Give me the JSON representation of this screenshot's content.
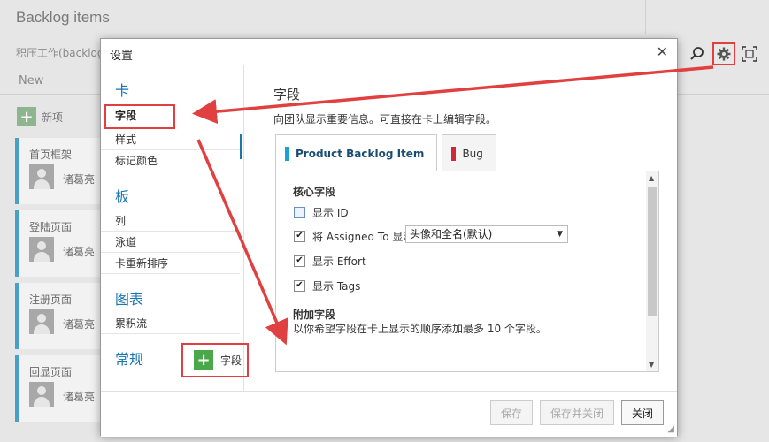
{
  "background": {
    "title": "Backlog items",
    "breadcrumb": "积压工作(backlog",
    "new_tab": "New",
    "new_button": "新项",
    "cards": [
      {
        "title": "首页框架",
        "owner": "诸葛亮"
      },
      {
        "title": "登陆页面",
        "owner": "诸葛亮"
      },
      {
        "title": "注册页面",
        "owner": "诸葛亮"
      },
      {
        "title": "回显页面",
        "owner": "诸葛亮"
      }
    ],
    "icons": {
      "search": "search-icon",
      "settings": "gear-icon",
      "fullscreen": "fullscreen-icon"
    }
  },
  "dialog": {
    "title": "设置",
    "close": "✕",
    "nav": {
      "sections": [
        {
          "label": "卡",
          "items": [
            "字段",
            "样式",
            "标记颜色"
          ]
        },
        {
          "label": "板",
          "items": [
            "列",
            "泳道",
            "卡重新排序"
          ]
        },
        {
          "label": "图表",
          "items": [
            "累积流"
          ]
        },
        {
          "label": "常规",
          "items": []
        }
      ],
      "active_item": "字段"
    },
    "content": {
      "title": "字段",
      "description": "向团队显示重要信息。可直接在卡上编辑字段。",
      "tabs": [
        {
          "label": "Product Backlog Item",
          "color": "#1ba1d4",
          "active": true
        },
        {
          "label": "Bug",
          "color": "#cc2a3b",
          "active": false
        }
      ],
      "core_heading": "核心字段",
      "core_fields": [
        {
          "label": "显示 ID",
          "checked": false
        },
        {
          "label": "将 Assigned To 显示为:",
          "checked": true
        },
        {
          "label": "显示 Effort",
          "checked": true
        },
        {
          "label": "显示 Tags",
          "checked": true
        }
      ],
      "assigned_select": "头像和全名(默认)",
      "extra_heading": "附加字段",
      "extra_description": "以你希望字段在卡上显示的顺序添加最多 10 个字段。",
      "add_field_label": "字段"
    },
    "footer": {
      "save": "保存",
      "save_close": "保存并关闭",
      "close": "关闭"
    }
  },
  "colors": {
    "accent": "#1a76b0",
    "annotation": "#e04040",
    "add_green": "#4aa84a"
  }
}
